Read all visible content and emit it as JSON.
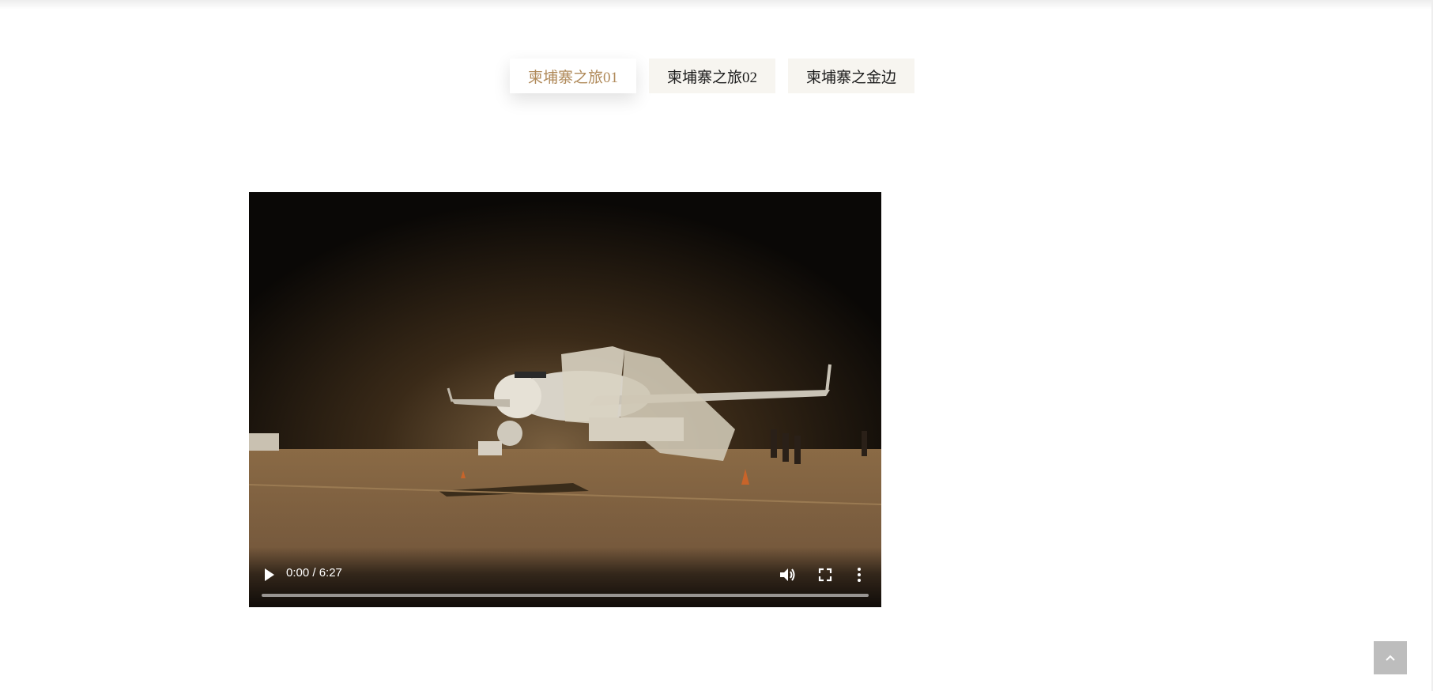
{
  "tabs": [
    {
      "label": "柬埔寨之旅01",
      "active": true
    },
    {
      "label": "柬埔寨之旅02",
      "active": false
    },
    {
      "label": "柬埔寨之金边",
      "active": false
    }
  ],
  "video": {
    "current_time": "0:00",
    "duration": "6:27",
    "time_display": "0:00 / 6:27",
    "progress": 0,
    "icons": {
      "play": "play-icon",
      "volume": "volume-icon",
      "fullscreen": "fullscreen-icon",
      "more": "more-vert-icon"
    }
  },
  "back_to_top": {
    "icon": "chevron-up-icon"
  },
  "colors": {
    "accent": "#b08a5a",
    "tab_bg": "#f7f5f0",
    "back_to_top_bg": "#bdbdbd"
  }
}
